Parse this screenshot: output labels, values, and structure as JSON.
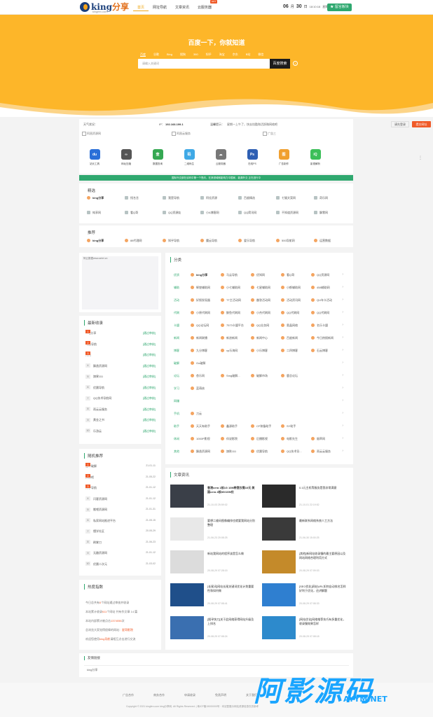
{
  "header": {
    "logo_text": "king",
    "logo_text_cn": "分享",
    "logo_sub": "kingfen.com",
    "nav": [
      {
        "label": "首页",
        "active": true
      },
      {
        "label": "网址导航",
        "active": false
      },
      {
        "label": "文章资讯",
        "active": false
      },
      {
        "label": "云服务器",
        "active": false,
        "badge": "HOT"
      }
    ],
    "clock": {
      "month": "06",
      "month_unit": "月",
      "day": "30",
      "day_unit": "日",
      "time": "18:10:16",
      "weekday": "星期五"
    },
    "guestbook_label": "留言板块"
  },
  "hero": {
    "title": "百度一下，你就知道",
    "engines": [
      "百度",
      "谷歌",
      "Bing",
      "搜狗",
      "360",
      "知乎",
      "淘宝",
      "京东",
      "B站",
      "微信"
    ],
    "active_engine": 0,
    "search_placeholder": "请输入关键词",
    "search_button": "百度搜索",
    "info_icon": "i"
  },
  "weather_bar": {
    "weather_label": "天气状况：",
    "ip_label": "IP：",
    "ip": "192.168.199.1",
    "tip_label": "温馨提示：",
    "tip": "星期一上午了，快去炫酷和活跃微网络吧",
    "login": "请先登录",
    "submit": "提交网址"
  },
  "ads": [
    "阿昌资源网",
    "阿昌云服务",
    "广告三"
  ],
  "apps": [
    {
      "label": "站长工具",
      "color": "#2a6fd8",
      "glyph": "du"
    },
    {
      "label": "网址压缩",
      "color": "#555555",
      "glyph": "∞"
    },
    {
      "label": "数据查询",
      "color": "#35a852",
      "glyph": "查"
    },
    {
      "label": "二维码生",
      "color": "#3fa9e6",
      "glyph": "码"
    },
    {
      "label": "云服务器",
      "color": "#777777",
      "glyph": "☁"
    },
    {
      "label": "在线PS",
      "color": "#2e5fb3",
      "glyph": "Ps"
    },
    {
      "label": "广告制作",
      "color": "#f0a030",
      "glyph": "图"
    },
    {
      "label": "影视解析",
      "color": "#3cbf59",
      "glyph": "iQ"
    }
  ],
  "notice": "国际外交部在谈判中第一个签约，在其领域和影响力中国家，能源外交 正在进行中",
  "featured": {
    "title": "精选",
    "items": [
      "king分享",
      "找名言",
      "我是导航",
      "阿佳资源",
      "百度精选",
      "七猫文案网",
      "奇乐网",
      "纯享网",
      "看Q哥",
      "QQ资源娃",
      "小A博客网",
      "QQ简讯网",
      "不知道资源网",
      "飘零网"
    ]
  },
  "recommend": {
    "title": "推荐",
    "items": [
      "king分享",
      "88代理网",
      "知乎导航",
      "魔云导航",
      "爱乐导航",
      "500导航网",
      "运营数据"
    ]
  },
  "left_ad_label": "阿云数据www.aeiei.cn",
  "latest": {
    "title": "最新收录",
    "items": [
      {
        "name": "king分享",
        "tag": "[通过审核]"
      },
      {
        "name": "马云导航",
        "tag": "[通过审核]"
      },
      {
        "name": "刀元",
        "tag": "[通过审核]"
      },
      {
        "name": "飘逸资源网",
        "tag": "[通过审核]"
      },
      {
        "name": "旗果111",
        "tag": "[通过审核]"
      },
      {
        "name": "优晨导航",
        "tag": "[通过审核]"
      },
      {
        "name": "QQ技术导航网",
        "tag": "[通过审核]"
      },
      {
        "name": "雨云云服务",
        "tag": "[通过审核]"
      },
      {
        "name": "黄金之书",
        "tag": "[通过审核]"
      },
      {
        "name": "乐游云",
        "tag": "[通过审核]"
      }
    ]
  },
  "random": {
    "title": "随机推荐",
    "items": [
      {
        "name": "傲牛破解",
        "date": "21-01-11"
      },
      {
        "name": "资源吧",
        "date": "21-05-22"
      },
      {
        "name": "知乎导航",
        "date": "21-01-12"
      },
      {
        "name": "闪客资源网",
        "date": "21-01-12"
      },
      {
        "name": "搬哩资源网",
        "date": "21-01-31"
      },
      {
        "name": "私家网站推进平台",
        "date": "21-05-15"
      },
      {
        "name": "懂学社区",
        "date": "20-05-29"
      },
      {
        "name": "刷掌刀",
        "date": "21-06-23"
      },
      {
        "name": "无趣资源网",
        "date": "21-01-12"
      },
      {
        "name": "优晨二次元",
        "date": "21-03-02"
      }
    ]
  },
  "stats": {
    "title": "热度指数",
    "lines": [
      {
        "pre": "今日总共有",
        "num": "0",
        "post": "个网站通过审核并收录"
      },
      {
        "pre": "本站累计收录",
        "num": "611",
        "post": "个网站 共有作文章 14 篇"
      },
      {
        "pre": "本站内部累计被点击",
        "num": "1374056",
        "post": "次"
      },
      {
        "pre": "总浏览大家觉得很棒的网站：",
        "num": "星哥影院",
        "post": ""
      },
      {
        "pre": "欢迎您使用",
        "num": "king导航",
        "post": "请相互点击进行交流"
      }
    ]
  },
  "categories": {
    "title": "分类",
    "rows": [
      {
        "name": "优质",
        "items": [
          "king分享",
          "马云导航",
          "优知网",
          "看Q哥",
          "QQ资源网"
        ]
      },
      {
        "name": "辅助",
        "items": [
          "辉煌辅助网",
          "小七辅助网",
          "七星辅助网",
          "小鹤辅助网",
          "458辅助网"
        ]
      },
      {
        "name": "活动",
        "items": [
          "好搜发现器",
          "TT主活动网",
          "趣答活动网",
          "活动资讯网",
          "QU年卡活动"
        ]
      },
      {
        "name": "代刷",
        "items": [
          "小原代刷网",
          "鲸鱼代刷网",
          "小杰代刷网",
          "QQ代刷网",
          "QQ代刷网"
        ]
      },
      {
        "name": "卡盟",
        "items": [
          "QQ论坛网",
          "7573卡盟平台",
          "QQ业务网",
          "奥晶网络",
          "名乐卡盟"
        ]
      },
      {
        "name": "新闻",
        "items": [
          "新闻联播",
          "新浪新闻",
          "新闻中心",
          "百度新闻",
          "今日热搜新闻"
        ]
      },
      {
        "name": "博客",
        "items": [
          "九分博客",
          "xp乐海网",
          "小乐博客",
          "二四博客",
          "石云博客"
        ]
      },
      {
        "name": "破解",
        "items": [
          "Go破解"
        ]
      },
      {
        "name": "论坛",
        "items": [
          "杏乐网",
          "Smg破解...",
          "破解市场",
          "鹿总论坛"
        ]
      },
      {
        "name": "学习",
        "items": [
          "蓝萌核"
        ]
      },
      {
        "name": "网赚",
        "items": []
      },
      {
        "name": "手机",
        "items": [
          "刀云"
        ]
      },
      {
        "name": "助手",
        "items": [
          "天天有助手",
          "鑫源助手",
          "CF装备助手",
          "SY助手"
        ]
      },
      {
        "name": "休闲",
        "items": [
          "1000P影视",
          "伴说影院",
          "后播影视",
          "电影先生",
          "烟草网"
        ]
      },
      {
        "name": "其他",
        "items": [
          "飘逸资源网",
          "旗陈111",
          "优晨导航",
          "QQ技术导...",
          "雨云云服务"
        ]
      }
    ]
  },
  "articles": {
    "title": "文章资讯",
    "items": [
      {
        "title": "香港cera 1核1G 10M带宽仅需10元 美国cera 4核8G/10M仅",
        "meta": "21-10-03 25:59:02",
        "bold": true,
        "color": "#3a3f48"
      },
      {
        "title": "0.1元主机等服务是我非常满意",
        "meta": "21-10-01 22:19:52",
        "bold": false,
        "color": "#2a2a2a"
      },
      {
        "title": "要想二维码图像编排也就要我网站分别整理",
        "meta": "21-06-23 20:08:25",
        "bold": false,
        "color": "#e8e8e8"
      },
      {
        "title": "最新联系网络系统人工方法",
        "meta": "21-06-30 15:00:25",
        "bold": false,
        "color": "#3a3a3a"
      },
      {
        "title": "新站我网站的程序该是怎么做",
        "meta": "20-08-29 07:28:15",
        "bold": false,
        "color": "#dcdcdc"
      },
      {
        "title": "[其他]新网站收录慢的最主要原因以及网站网络合理利用方式",
        "meta": "20-08-29 07:09:03",
        "bold": false,
        "color": "#c48a2a"
      },
      {
        "title": "[长尾词]网站长尾关键词优化计划重要性和如何做",
        "meta": "20-08-29 07:08:41",
        "bold": false,
        "color": "#1f4f8a"
      },
      {
        "title": "[SEO优化]网站URL如何自动排名怎样好利于优化，还讲解题",
        "meta": "20-08-29 07:08:33",
        "bold": false,
        "color": "#2f7fd0"
      },
      {
        "title": "[搜寻快刀]关于此网络获得网站升级及上排名",
        "meta": "20-08-29 07:08:24",
        "bold": false,
        "color": "#3a6fb0"
      },
      {
        "title": "[网站优化]网络推荐技巧有多重优化，收录慢效果怎样",
        "meta": "20-08-29 07:08:18",
        "bold": false,
        "color": "#2d8acc"
      }
    ]
  },
  "links": {
    "title": "友情链接",
    "items": [
      "king分享"
    ]
  },
  "footer": {
    "links": [
      "广告合作",
      "商务合作",
      "申请收录",
      "免责声明",
      "关于我们"
    ],
    "copyright": "Copyright © 2021 kingfen.com king分享网. All Rights Reserved. | 粤ICP备19000000号 · 本站暂展示网站资源信息仅供参考"
  },
  "watermark": {
    "text": "阿影源码",
    "sub": "AYYM.NET"
  }
}
